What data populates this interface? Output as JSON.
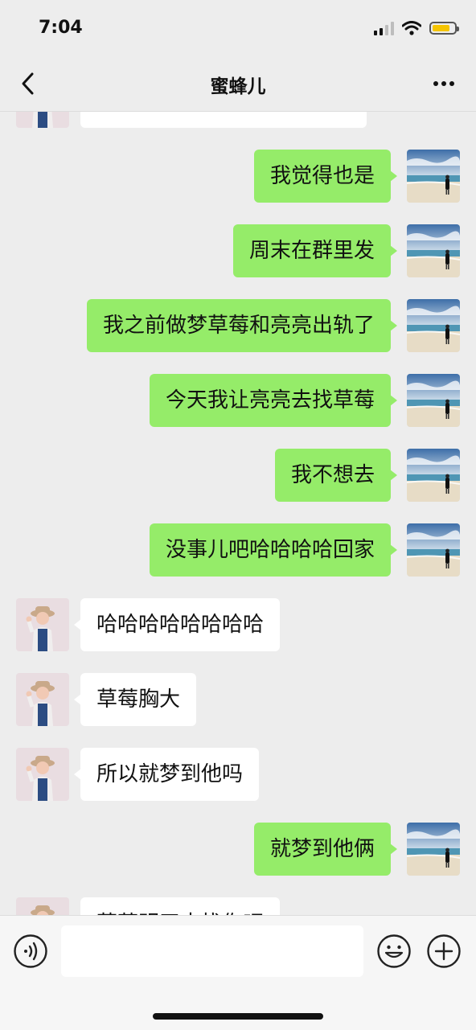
{
  "status_bar": {
    "time": "7:04",
    "battery_level": 0.8
  },
  "nav": {
    "title": "蜜蜂儿"
  },
  "messages": [
    {
      "direction": "in",
      "text": ""
    },
    {
      "direction": "out",
      "text": "我觉得也是"
    },
    {
      "direction": "out",
      "text": "周末在群里发"
    },
    {
      "direction": "out",
      "text": "我之前做梦草莓和亮亮出轨了"
    },
    {
      "direction": "out",
      "text": "今天我让亮亮去找草莓"
    },
    {
      "direction": "out",
      "text": "我不想去"
    },
    {
      "direction": "out",
      "text": "没事儿吧哈哈哈哈回家"
    },
    {
      "direction": "in",
      "text": "哈哈哈哈哈哈哈哈"
    },
    {
      "direction": "in",
      "text": "草莓胸大"
    },
    {
      "direction": "in",
      "text": "所以就梦到他吗"
    },
    {
      "direction": "out",
      "text": "就梦到他俩"
    },
    {
      "direction": "in",
      "text": "草莓明天去找你吧"
    }
  ],
  "input": {
    "value": "",
    "placeholder": ""
  },
  "colors": {
    "outgoing_bubble": "#95ec69",
    "incoming_bubble": "#ffffff",
    "background": "#ededed"
  }
}
